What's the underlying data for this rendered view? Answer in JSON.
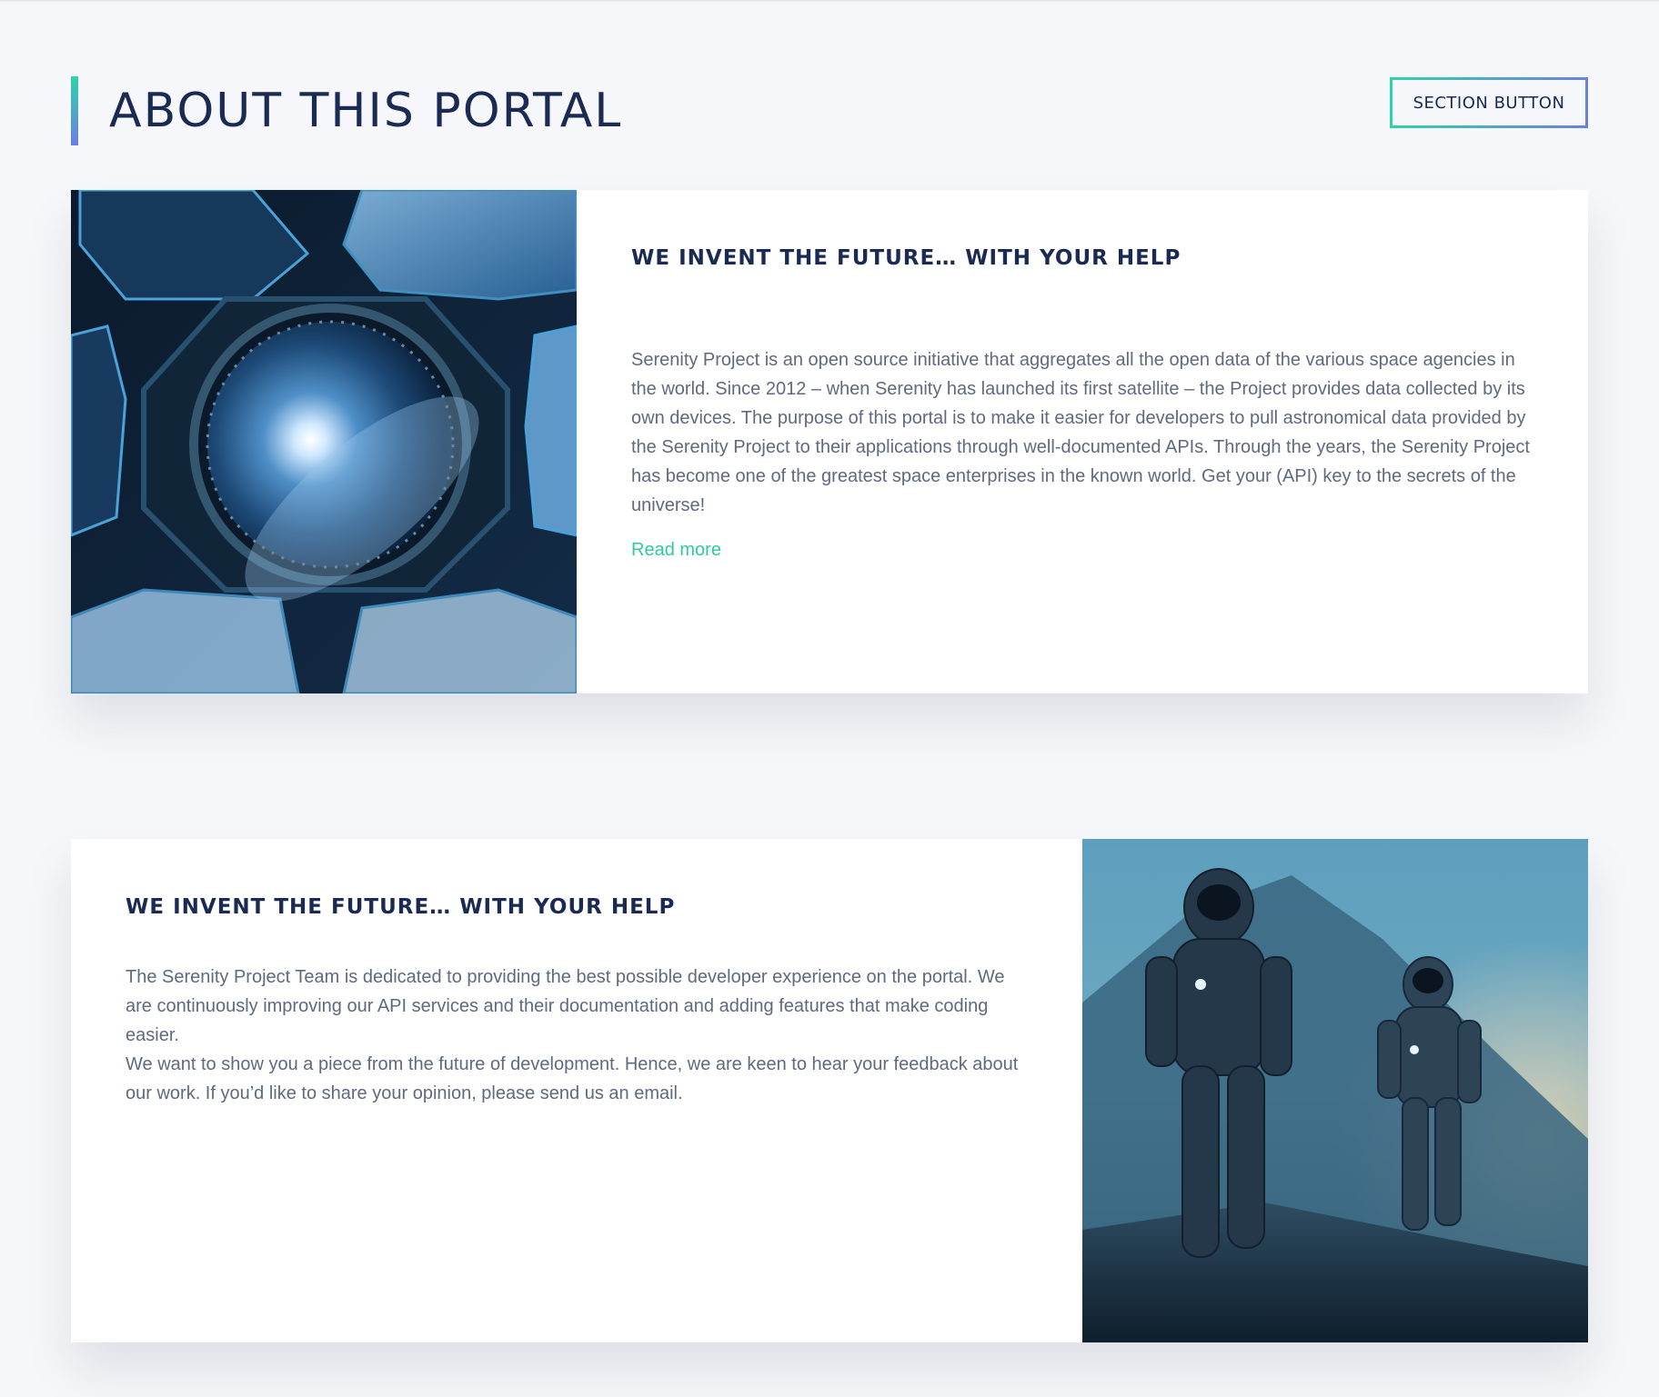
{
  "header": {
    "title": "ABOUT THIS PORTAL",
    "section_button_label": "SECTION BUTTON"
  },
  "cards": [
    {
      "heading": "WE INVENT THE FUTURE… WITH YOUR HELP",
      "paragraphs": [
        "Serenity Project is an open source initiative that aggregates all the open data of the various space agencies in the world. Since 2012 – when Serenity has launched its first satellite – the Project provides data collected by its own devices. The purpose of this portal is to make it easier for developers to pull astronomical data provided by the Serenity Project to their applications through well-documented APIs. Through the years, the Serenity Project has become one of the greatest space enterprises in the known world. Get your (API) key to the secrets of the universe!"
      ],
      "link_label": "Read more",
      "image": "space-station-window-earth"
    },
    {
      "heading": "WE INVENT THE FUTURE… WITH YOUR HELP",
      "paragraphs": [
        "The Serenity Project Team is dedicated to providing the best possible developer experience on the portal. We are continuously improving our API services and their documentation and adding features that make coding easier.",
        "We want to show you a piece from the future of development. Hence, we are keen to hear your feedback about our work. If you’d like to share your opinion, please send us an email."
      ],
      "image": "astronauts-walking"
    }
  ],
  "colors": {
    "background": "#f6f7fa",
    "title": "#1a2a52",
    "body_text": "#5f6a7e",
    "link": "#2fc9a0",
    "gradient_start": "#2fd3a8",
    "gradient_end": "#6b7fe3"
  }
}
